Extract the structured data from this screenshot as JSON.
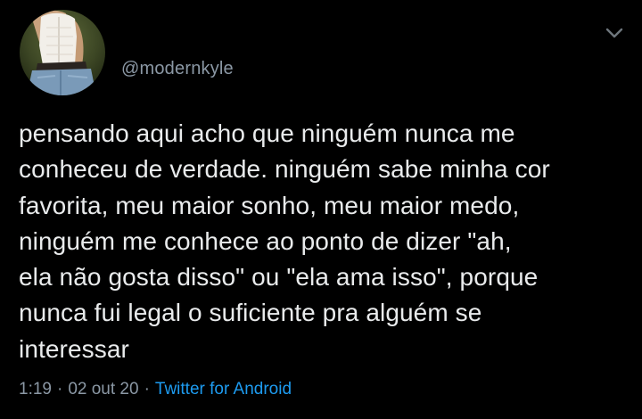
{
  "tweet": {
    "handle": "@modernkyle",
    "text": "pensando aqui acho que ninguém nunca me\nconheceu de verdade. ninguém sabe minha cor\nfavorita, meu maior sonho, meu maior medo,\nninguém me conhece ao ponto de dizer \"ah,\nela não gosta disso\" ou \"ela ama isso\", porque\nnunca fui legal o suficiente pra alguém se\ninteressar",
    "time": "1:19",
    "date": "02 out 20",
    "separator": "·",
    "source": "Twitter for Android"
  },
  "icons": {
    "avatar": "profile-photo",
    "more": "chevron-down-icon"
  },
  "colors": {
    "background": "#000000",
    "text": "#e9ebec",
    "muted": "#8b98a5",
    "link": "#1d9bf0"
  }
}
